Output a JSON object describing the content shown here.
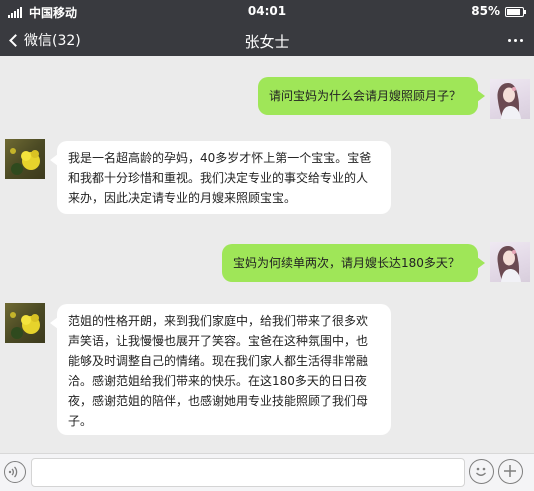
{
  "status_bar": {
    "carrier": "中国移动",
    "time": "04:01",
    "battery": "85%",
    "battery_level": 0.85
  },
  "nav": {
    "back_label": "微信(32)",
    "title": "张女士"
  },
  "messages": [
    {
      "side": "out",
      "text": "请问宝妈为什么会请月嫂照顾月子？",
      "avatar": "girl-avatar"
    },
    {
      "side": "in",
      "lines": [
        "我是一名超高龄的孕妈，40多岁才怀上第一个宝宝。宝爸",
        "和我都十分珍惜和重视。我们决定专业的事交给专业的人",
        "来办，因此决定请专业的月嫂来照顾宝宝。"
      ],
      "avatar": "flower-avatar"
    },
    {
      "side": "out",
      "text": "宝妈为何续单两次，请月嫂长达180多天？",
      "avatar": "girl-avatar"
    },
    {
      "side": "in",
      "lines": [
        "范姐的性格开朗，来到我们家庭中，给我们带来了很多欢",
        "声笑语，让我慢慢也展开了笑容。宝爸在这种氛围中，也",
        "能够及时调整自己的情绪。现在我们家人都生活得非常融",
        "洽。感谢范姐给我们带来的快乐。在这180多天的日日夜",
        "夜，感谢范姐的陪伴，也感谢她用专业技能照顾了我们母",
        "子。"
      ],
      "avatar": "flower-avatar"
    }
  ],
  "input": {
    "value": "",
    "placeholder": ""
  },
  "colors": {
    "bar_background": "#393a3f",
    "chat_background": "#ebebeb",
    "outgoing_bubble": "#9fe658",
    "incoming_bubble": "#ffffff"
  },
  "icons": {
    "signal": "signal-icon",
    "battery": "battery-icon",
    "back": "chevron-left-icon",
    "more": "more-icon",
    "voice": "voice-icon",
    "emoji": "emoji-icon",
    "plus": "plus-icon"
  }
}
